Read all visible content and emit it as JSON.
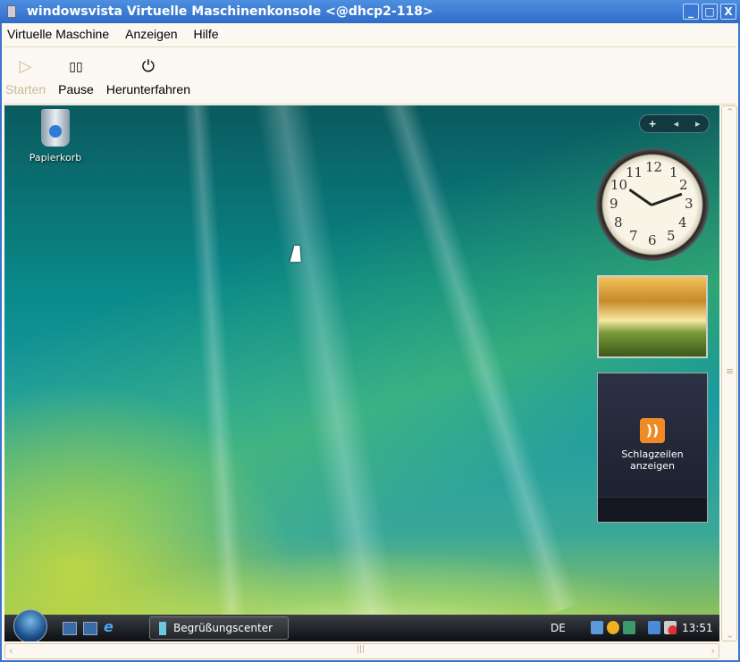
{
  "window": {
    "title": "windowsvista Virtuelle Maschinenkonsole <@dhcp2-118>",
    "min": "_",
    "max": "□",
    "close": "X"
  },
  "menu": [
    {
      "label": "Virtuelle Maschine"
    },
    {
      "label": "Anzeigen"
    },
    {
      "label": "Hilfe"
    }
  ],
  "toolbar": {
    "start": {
      "label": "Starten",
      "icon": "▷"
    },
    "pause": {
      "label": "Pause",
      "icon": "▯▯"
    },
    "shutdown": {
      "label": "Herunterfahren",
      "icon": "⏻"
    }
  },
  "desktop": {
    "recycle_bin": "Papierkorb",
    "sidebar_add": "+",
    "sidebar_prev": "◂",
    "sidebar_next": "▸",
    "feed_label": "Schlagzeilen anzeigen",
    "feed_icon": "))"
  },
  "clock": {
    "numbers": [
      "12",
      "1",
      "2",
      "3",
      "4",
      "5",
      "6",
      "7",
      "8",
      "9",
      "10",
      "11"
    ]
  },
  "taskbar": {
    "task": "Begrüßungscenter",
    "lang": "DE",
    "time": "13:51"
  },
  "scroll": {
    "up": "⌃",
    "down": "⌄",
    "left": "‹",
    "right": "›",
    "grip": "|||",
    "vgrip": "≡"
  }
}
